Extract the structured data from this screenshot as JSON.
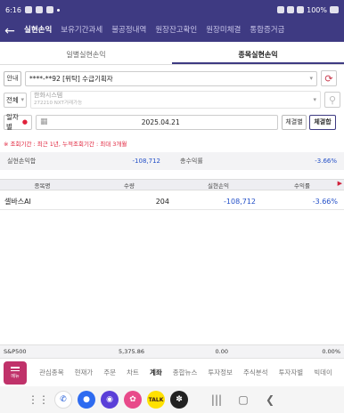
{
  "status_bar": {
    "time": "6:16",
    "battery": "100%"
  },
  "top_nav": {
    "tabs": [
      "실현손익",
      "보유기간과세",
      "불공정내역",
      "원장잔고확인",
      "원장미체결",
      "통합증거금"
    ],
    "active_index": 0
  },
  "sub_tabs": {
    "tabs": [
      "일별실현손익",
      "종목실현손익"
    ],
    "active_index": 1
  },
  "form": {
    "guide_label": "안내",
    "account_value": "****-**92 [위탁] 수급기획자",
    "scope_select": "전체",
    "stock_placeholder": "한화시스템",
    "stock_sub_placeholder": "272210 NXT거래가능",
    "period_select": "일자별",
    "date_value": "2025.04.21",
    "basis_button": "체결별",
    "basis_button_active": "체결합"
  },
  "notice": "※ 조회기간 : 최근 1년, 누적조회기간 : 최대 3개월",
  "summary": {
    "realized_label": "실현손익합",
    "realized_value": "-108,712",
    "total_return_label": "총수익률",
    "total_return_value": "-3.66%"
  },
  "table": {
    "headers": [
      "종목명",
      "수량",
      "실현손익",
      "수익률"
    ],
    "rows": [
      {
        "name": "셀바스AI",
        "qty": "204",
        "pnl": "-108,712",
        "rate": "-3.66%"
      }
    ]
  },
  "ticker": {
    "index_name": "S&P500",
    "price": "5,375.86",
    "change": "0.00",
    "pct": "0.00%"
  },
  "bottom_menu": {
    "menu_label": "메뉴",
    "items": [
      "관심종목",
      "현재가",
      "주문",
      "차트",
      "계좌",
      "종합뉴스",
      "투자정보",
      "주식분석",
      "투자자별",
      "빅데이"
    ],
    "active_index": 4
  },
  "colors": {
    "primary": "#3e3a82",
    "accent_red": "#e0213a",
    "loss_blue": "#2450c8",
    "menu_pink": "#c0326a"
  }
}
